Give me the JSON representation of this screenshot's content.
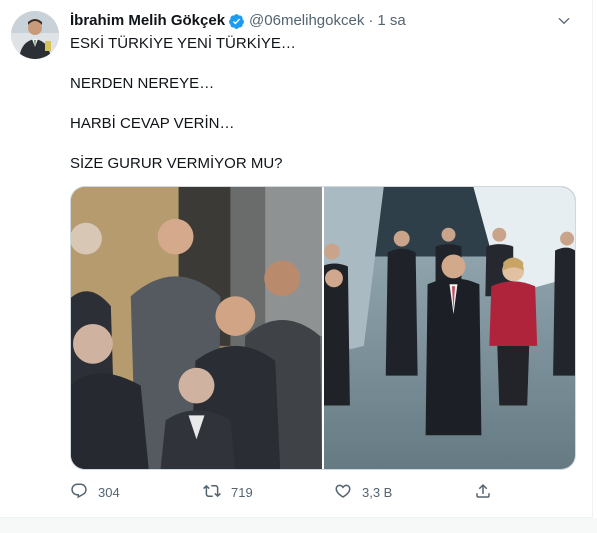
{
  "tweet": {
    "display_name": "İbrahim Melih Gökçek",
    "handle": "@06melihgokcek",
    "separator": "·",
    "timestamp": "1 sa",
    "avatar_icon": "profile-photo",
    "verified_icon": "verified-badge-icon",
    "more_icon": "chevron-down-icon",
    "lines": [
      "ESKİ TÜRKİYE YENİ TÜRKİYE…",
      "NERDEN NEREYE…",
      "HARBİ CEVAP VERİN…",
      "SİZE GURUR VERMİYOR MU?"
    ],
    "media": [
      {
        "name": "photo-left",
        "description": "old-group-photo"
      },
      {
        "name": "photo-right",
        "description": "new-group-photo"
      }
    ],
    "actions": {
      "reply": {
        "icon": "reply-icon",
        "count": "304"
      },
      "retweet": {
        "icon": "retweet-icon",
        "count": "719"
      },
      "like": {
        "icon": "heart-icon",
        "count": "3,3 B"
      },
      "share": {
        "icon": "share-icon",
        "count": ""
      }
    }
  },
  "colors": {
    "text": "#0f1419",
    "secondary": "#536471",
    "verified": "#1d9bf0",
    "border": "#cfd9de"
  }
}
